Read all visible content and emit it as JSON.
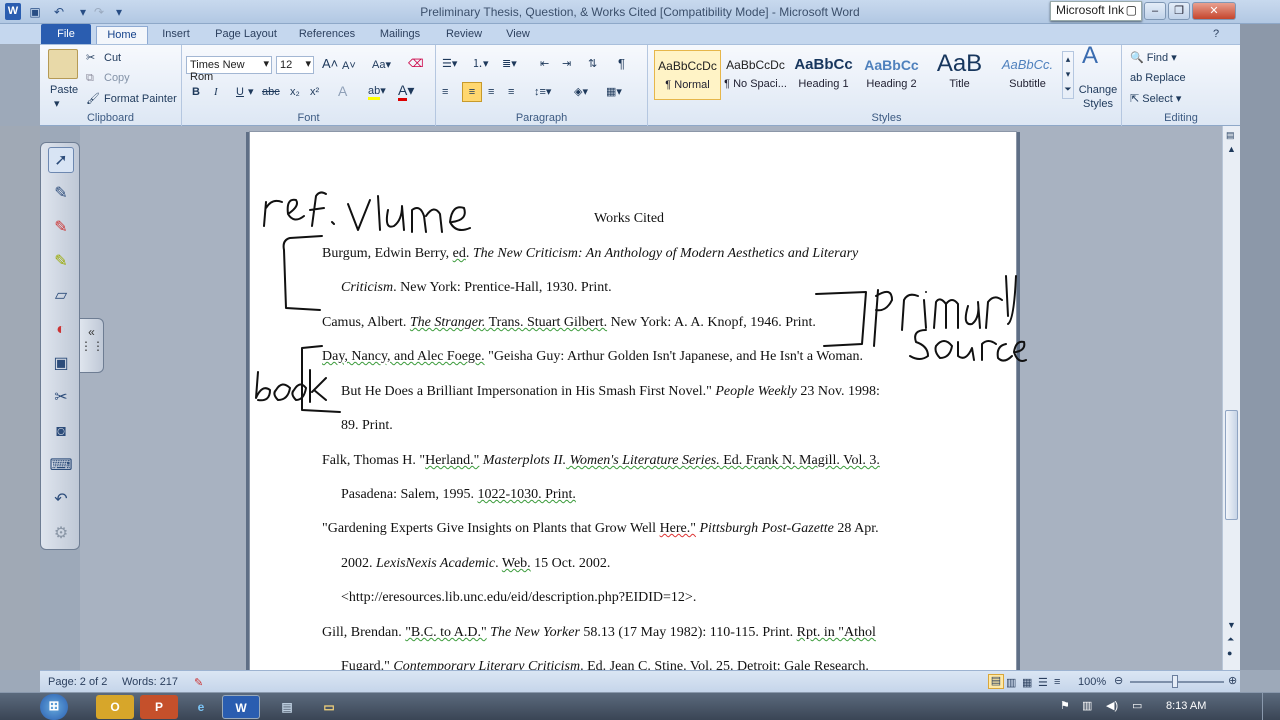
{
  "window": {
    "title": "Preliminary Thesis, Question, & Works Cited [Compatibility Mode] - Microsoft Word",
    "ink_widget": "Microsoft Ink"
  },
  "tabs": [
    "File",
    "Home",
    "Insert",
    "Page Layout",
    "References",
    "Mailings",
    "Review",
    "View"
  ],
  "ribbon": {
    "clipboard": {
      "paste": "Paste",
      "cut": "Cut",
      "copy": "Copy",
      "format_painter": "Format Painter",
      "label": "Clipboard"
    },
    "font": {
      "name": "Times New Rom",
      "size": "12",
      "label": "Font",
      "bold": "B",
      "italic": "I",
      "underline": "U",
      "grow": "A",
      "shrink": "A",
      "case": "Aa"
    },
    "paragraph": {
      "label": "Paragraph"
    },
    "styles": {
      "label": "Styles",
      "tiles": [
        {
          "sample": "AaBbCcDc",
          "name": "¶ Normal"
        },
        {
          "sample": "AaBbCcDc",
          "name": "¶ No Spaci..."
        },
        {
          "sample": "AaBbCc",
          "name": "Heading 1"
        },
        {
          "sample": "AaBbCc",
          "name": "Heading 2"
        },
        {
          "sample": "AaB",
          "name": "Title"
        },
        {
          "sample": "AaBbCc.",
          "name": "Subtitle"
        }
      ],
      "change_styles": "Change Styles"
    },
    "editing": {
      "find": "Find",
      "replace": "Replace",
      "select": "Select",
      "label": "Editing"
    }
  },
  "document": {
    "heading": "Works Cited",
    "entries": {
      "burgum_1a": "Burgum, Edwin Berry, ",
      "burgum_ed": "ed",
      "burgum_1b": ". ",
      "burgum_1c": "The New Criticism: An Anthology of Modern Aesthetics and Literary",
      "burgum_2a": "Criticism",
      "burgum_2b": ".  New York: Prentice-Hall, 1930. Print.",
      "camus_a": "Camus, Albert. ",
      "camus_b": "The Stranger.",
      "camus_c": " Trans. Stuart Gilbert.",
      "camus_d": " New York: A. A. Knopf, 1946. Print.",
      "day_a": "Day, Nancy, and Alec Foege.",
      "day_b": " \"Geisha Guy: Arthur Golden Isn't Japanese, and He Isn't a Woman.",
      "day_2a": "But He Does a Brilliant Impersonation in His Smash First Novel.\" ",
      "day_2b": "People Weekly",
      "day_2c": " 23 Nov. 1998:",
      "day_3": "89. Print.",
      "falk_a": "Falk, Thomas  H. \"",
      "falk_b": "Herland.\"",
      "falk_c": " Masterplots  II.",
      "falk_d": " Women's Literature Series.",
      "falk_e": " Ed. Frank N. Magill. Vol. 3.",
      "falk_2a": "Pasadena: Salem, 1995. ",
      "falk_2b": "1022-1030. Print.",
      "gard_a": "\"Gardening Experts Give Insights on Plants that Grow Well ",
      "gard_b": "Here.\"",
      "gard_c": " Pittsburgh  Post-Gazette",
      "gard_d": " 28 Apr.",
      "gard_2a": "2002. ",
      "gard_2b": "LexisNexis Academic",
      "gard_2c": ". ",
      "gard_2d": "Web.",
      "gard_2e": " 15 Oct. 2002.",
      "gard_3": "<http://eresources.lib.unc.edu/eid/description.php?EIDID=12>.",
      "gill_a": "Gill, Brendan. ",
      "gill_b": "\"B.C. to A.D.\"",
      "gill_c": " The New Yorker",
      "gill_d": " 58.13 (17 May 1982): 110-115. Print. ",
      "gill_e": "Rpt. in \"Athol",
      "gill_2a": "Fugard.\" ",
      "gill_2b": "Contemporary Literary Criticism",
      "gill_2c": ". Ed. Jean C. Stine. Vol. 25. Detroit: Gale Research."
    }
  },
  "status": {
    "page": "Page: 2 of 2",
    "words": "Words: 217",
    "zoom": "100%"
  },
  "taskbar": {
    "clock": "8:13 AM"
  }
}
